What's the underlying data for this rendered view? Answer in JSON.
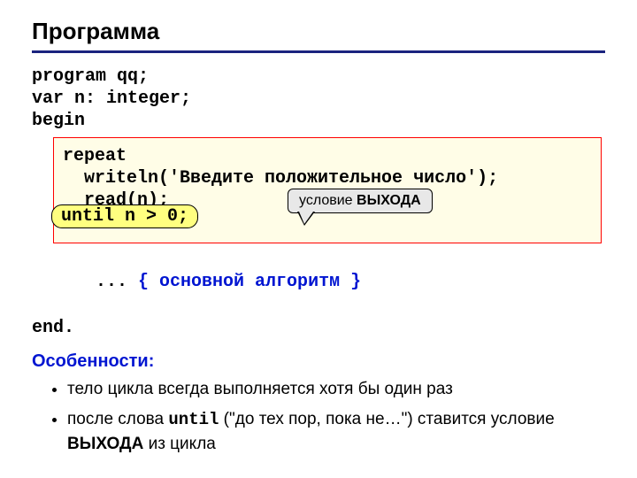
{
  "title": "Программа",
  "code": {
    "l1": "program qq;",
    "l2": "var n: integer;",
    "l3": "begin",
    "box_l1": "repeat",
    "box_l2": "  writeln('Введите положительное число');",
    "box_l3": "  read(n);",
    "until_full": "until n > 0;",
    "after_box_prefix": "... ",
    "after_box_comment": "{ основной алгоритм }",
    "end": "end."
  },
  "callout": {
    "prefix": "условие ",
    "bold": "ВЫХОДА"
  },
  "features": {
    "heading": "Особенности:",
    "item1": "тело цикла всегда выполняется хотя бы один раз",
    "item2_p1": "после слова ",
    "item2_code": "until",
    "item2_p2": " (\"до тех пор, пока не…\") ставится условие ",
    "item2_bold": "ВЫХОДА",
    "item2_p3": " из цикла"
  }
}
